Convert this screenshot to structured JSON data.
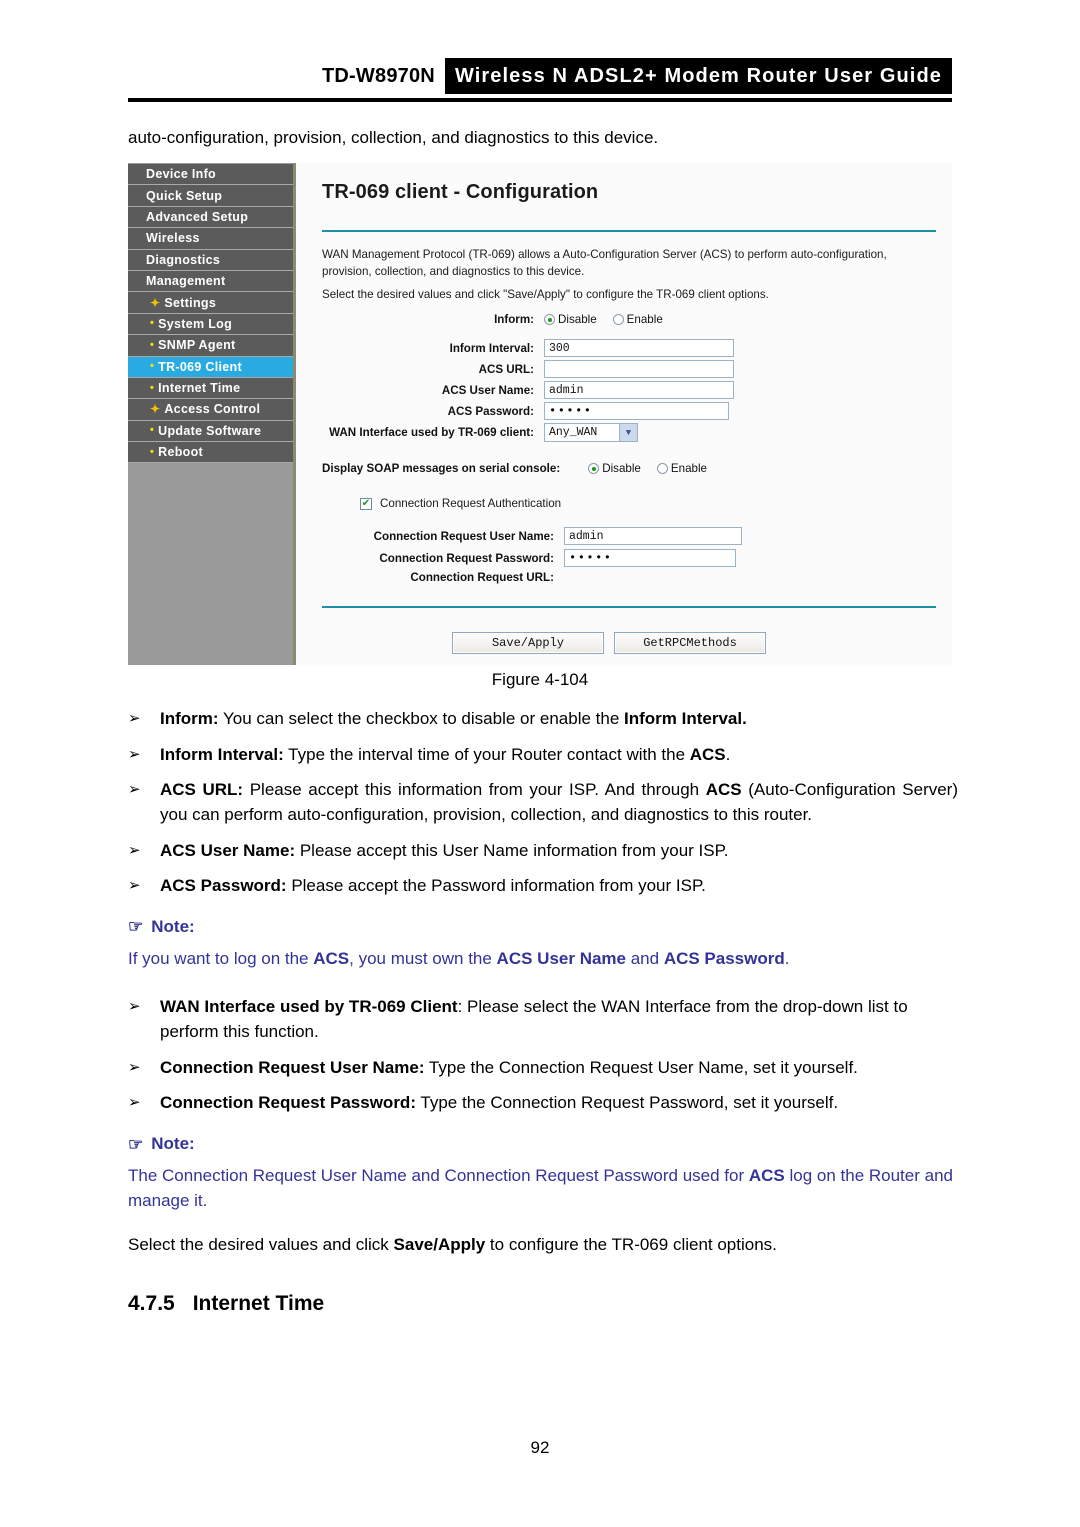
{
  "header": {
    "model": "TD-W8970N",
    "title": "Wireless N ADSL2+ Modem Router User Guide"
  },
  "intro_line": "auto-configuration, provision, collection, and diagnostics to this device.",
  "router_ui": {
    "sidebar": {
      "items": [
        {
          "label": "Device Info",
          "level": "top",
          "bullet": "",
          "active": false
        },
        {
          "label": "Quick Setup",
          "level": "top",
          "bullet": "",
          "active": false
        },
        {
          "label": "Advanced Setup",
          "level": "top",
          "bullet": "",
          "active": false
        },
        {
          "label": "Wireless",
          "level": "top",
          "bullet": "",
          "active": false
        },
        {
          "label": "Diagnostics",
          "level": "top",
          "bullet": "",
          "active": false
        },
        {
          "label": "Management",
          "level": "top",
          "bullet": "",
          "active": false
        },
        {
          "label": "Settings",
          "level": "sub",
          "bullet": "plus",
          "active": false
        },
        {
          "label": "System Log",
          "level": "sub",
          "bullet": "dot",
          "active": false
        },
        {
          "label": "SNMP Agent",
          "level": "sub",
          "bullet": "dot",
          "active": false
        },
        {
          "label": "TR-069 Client",
          "level": "sub",
          "bullet": "dot",
          "active": true
        },
        {
          "label": "Internet Time",
          "level": "sub",
          "bullet": "dot",
          "active": false
        },
        {
          "label": "Access Control",
          "level": "sub",
          "bullet": "plus",
          "active": false
        },
        {
          "label": "Update Software",
          "level": "sub",
          "bullet": "dot",
          "active": false
        },
        {
          "label": "Reboot",
          "level": "sub",
          "bullet": "dot",
          "active": false
        }
      ]
    },
    "panel": {
      "title": "TR-069 client - Configuration",
      "description": "WAN Management Protocol (TR-069) allows a Auto-Configuration Server (ACS) to perform auto-configuration, provision, collection, and diagnostics to this device.",
      "description2": "Select the desired values and click \"Save/Apply\" to configure the TR-069 client options.",
      "inform": {
        "label": "Inform:",
        "options": [
          "Disable",
          "Enable"
        ],
        "selected": "Disable"
      },
      "fields": {
        "inform_interval_label": "Inform Interval:",
        "inform_interval_value": "300",
        "acs_url_label": "ACS URL:",
        "acs_url_value": "",
        "acs_user_label": "ACS User Name:",
        "acs_user_value": "admin",
        "acs_pass_label": "ACS Password:",
        "acs_pass_value": "•••••",
        "wan_iface_label": "WAN Interface used by TR-069 client:",
        "wan_iface_value": "Any_WAN"
      },
      "soap": {
        "label": "Display SOAP messages on serial console:",
        "options": [
          "Disable",
          "Enable"
        ],
        "selected": "Disable"
      },
      "auth_checkbox": {
        "label": "Connection Request Authentication",
        "checked": true,
        "check_glyph": "✔"
      },
      "connection_request": {
        "user_label": "Connection Request User Name:",
        "user_value": "admin",
        "pass_label": "Connection Request Password:",
        "pass_value": "•••••",
        "url_label": "Connection Request URL:",
        "url_value": ""
      },
      "buttons": {
        "save": "Save/Apply",
        "getrpc": "GetRPCMethods"
      }
    }
  },
  "figure_caption": "Figure 4-104",
  "bullets": {
    "marker": "➢",
    "items": [
      {
        "term": "Inform:",
        "rest_a": " You can select the checkbox to disable or enable the ",
        "term_b": "Inform Interval.",
        "rest_b": ""
      },
      {
        "term": "Inform Interval:",
        "rest_a": " Type the interval time of your Router contact with the ",
        "term_b": "ACS",
        "rest_b": "."
      },
      {
        "term": "ACS URL:",
        "rest_a": " Please accept this information from your ISP. And through ",
        "term_b": "ACS",
        "rest_b": " (Auto-Configuration Server) you can perform auto-configuration, provision, collection, and diagnostics to this router."
      },
      {
        "term": "ACS User Name:",
        "rest_a": " Please accept this User Name information from your ISP.",
        "term_b": "",
        "rest_b": ""
      },
      {
        "term": "ACS Password:",
        "rest_a": " Please accept the Password information from your ISP.",
        "term_b": "",
        "rest_b": ""
      }
    ],
    "items2": [
      {
        "term": "WAN Interface used by TR-069 Client",
        "rest_a": ": Please select the WAN Interface from the drop-down list to perform this function.",
        "term_b": "",
        "rest_b": ""
      },
      {
        "term": "Connection Request User Name:",
        "rest_a": " Type the Connection Request User Name, set it yourself.",
        "term_b": "",
        "rest_b": ""
      },
      {
        "term": "Connection Request Password:",
        "rest_a": " Type the Connection Request Password, set it yourself.",
        "term_b": "",
        "rest_b": ""
      }
    ]
  },
  "note1": {
    "hand_glyph": "☞",
    "heading": "Note:",
    "text_a": "If you want to log on the ",
    "bold_a": "ACS",
    "text_b": ", you must own the ",
    "bold_b": "ACS User Name",
    "text_c": " and ",
    "bold_c": "ACS Password",
    "text_d": "."
  },
  "note2": {
    "hand_glyph": "☞",
    "heading": "Note:",
    "text_a": "The Connection Request User Name and Connection Request Password used for ",
    "bold_a": "ACS",
    "text_b": " log on the Router and manage it."
  },
  "closing_paragraph": {
    "text_a": "Select the desired values and click ",
    "bold_a": "Save/Apply",
    "text_b": " to configure the TR-069 client options."
  },
  "section": {
    "number": "4.7.5",
    "title": "Internet Time"
  },
  "page_number": "92",
  "colors": {
    "note_blue": "#333399",
    "active_menu": "#29abe2",
    "menu_bg": "#5b5b5b",
    "sidebar_bg": "#9a9a9a",
    "rule_teal": "#1f8fa4",
    "radio_green": "#1a9a1a",
    "bullet_yellow": "#f2e205"
  }
}
